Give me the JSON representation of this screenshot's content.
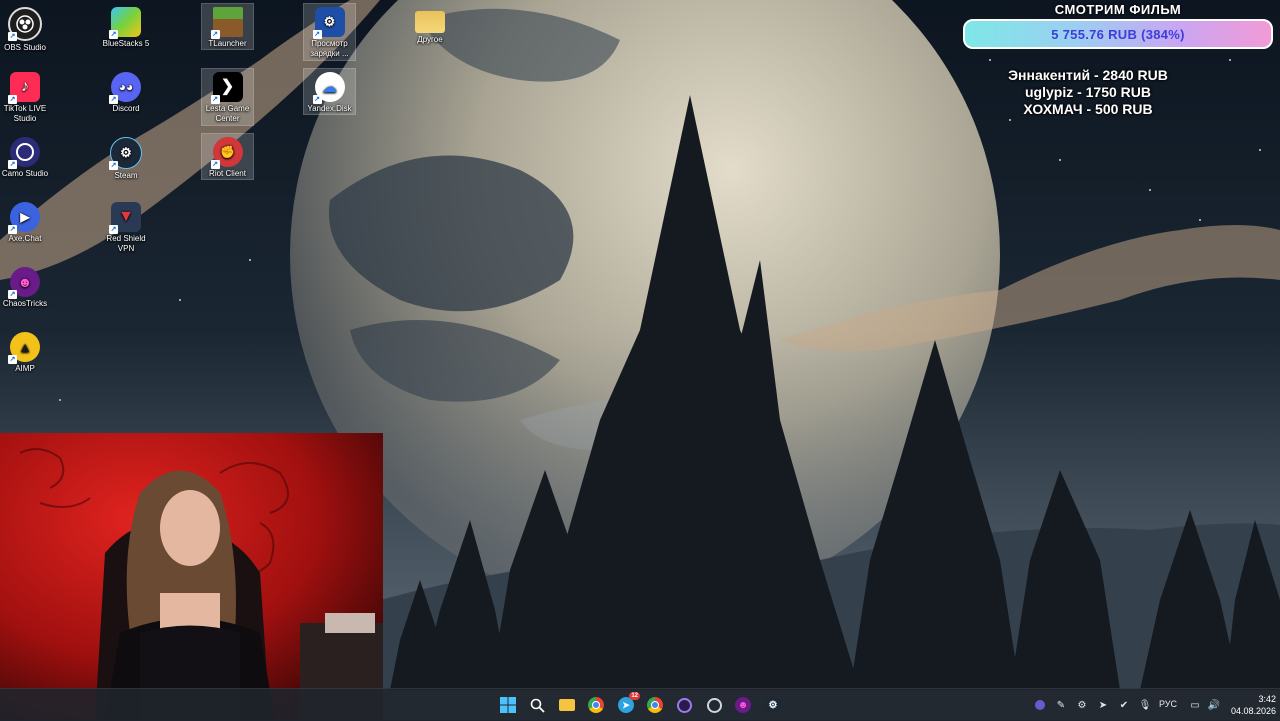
{
  "desktop": {
    "icons": [
      {
        "label": "OBS Studio"
      },
      {
        "label": "TikTok LIVE Studio"
      },
      {
        "label": "Camo Studio"
      },
      {
        "label": "Axe.Chat"
      },
      {
        "label": "ChaosTricks"
      },
      {
        "label": "AIMP"
      },
      {
        "label": "BlueStacks 5"
      },
      {
        "label": "Discord"
      },
      {
        "label": "Steam"
      },
      {
        "label": "Red Shield VPN"
      },
      {
        "label": "TLauncher"
      },
      {
        "label": "Lesta Game Center"
      },
      {
        "label": "Riot Client"
      },
      {
        "label": "Просмотр зарядки ..."
      },
      {
        "label": "Yandex.Disk"
      },
      {
        "label": "Другое"
      }
    ]
  },
  "donation": {
    "title": "СМОТРИМ ФИЛЬМ",
    "amount": "5 755.76 RUB (384%)",
    "progress_percent": 384,
    "donors": [
      "Эннакентий - 2840 RUB",
      "uglypiz - 1750 RUB",
      "ХОХМАЧ - 500 RUB"
    ]
  },
  "taskbar": {
    "apps": [
      "windows-start",
      "search",
      "file-explorer",
      "chrome",
      "telegram-badge",
      "chrome-alt",
      "obs",
      "steam-helper",
      "chaostricks",
      "steam"
    ],
    "notification_badge": "12",
    "tray": {
      "language": "РУС",
      "time": "3:42",
      "date": "04.08.2026"
    }
  },
  "colors": {
    "bar_gradient_start": "#7ee7e7",
    "bar_gradient_end": "#f29ad6",
    "amount_text": "#3d3ddc",
    "taskbar": "#20242c"
  }
}
